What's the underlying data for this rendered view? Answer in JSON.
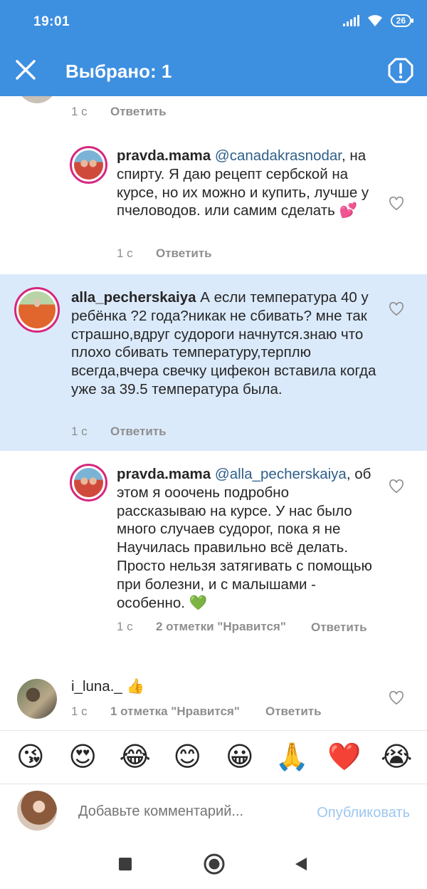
{
  "status_bar": {
    "time": "19:01",
    "battery": "26"
  },
  "app_bar": {
    "title": "Выбрано: 1"
  },
  "comments": [
    {
      "time": "1 с",
      "reply": "Ответить"
    },
    {
      "username": "pravda.mama",
      "mention": "@canadakrasnodar",
      "text": ", на спирту. Я даю рецепт сербской на курсе, но их можно и купить, лучше у пчеловодов. или самим сделать 💕",
      "time": "1 с",
      "reply": "Ответить"
    },
    {
      "username": "alla_pecherskaiya",
      "text": " А если температура 40 у ребёнка ?2 года?никак не сбивать? мне так страшно,вдруг судороги начнутся.знаю что плохо сбивать температуру,терплю всегда,вчера свечку цифекон вставила когда уже за 39.5 температура была.",
      "time": "1 с",
      "reply": "Ответить"
    },
    {
      "username": "pravda.mama",
      "mention": "@alla_pecherskaiya",
      "text": ", об этом я ооочень подробно рассказываю на курсе. У нас было много случаев судорог, пока я не Научилась правильно всё делать. Просто нельзя затягивать с помощью при болезни, и с малышами - особенно. 💚",
      "time": "1 с",
      "likes": "2 отметки \"Нравится\"",
      "reply": "Ответить"
    },
    {
      "username": "i_luna._",
      "text": " 👍",
      "time": "1 с",
      "likes": "1 отметка \"Нравится\"",
      "reply": "Ответить"
    }
  ],
  "emoji_bar": [
    "😘",
    "😍",
    "😂",
    "😊",
    "😀",
    "🙏",
    "❤️",
    "😭"
  ],
  "compose": {
    "placeholder": "Добавьте комментарий...",
    "publish": "Опубликовать"
  },
  "colors": {
    "accent": "#3d8fe0",
    "selected_bg": "#dbeafb",
    "mention": "#2e5f8a",
    "meta": "#8e8e8e",
    "story_ring": "#d6277d"
  }
}
